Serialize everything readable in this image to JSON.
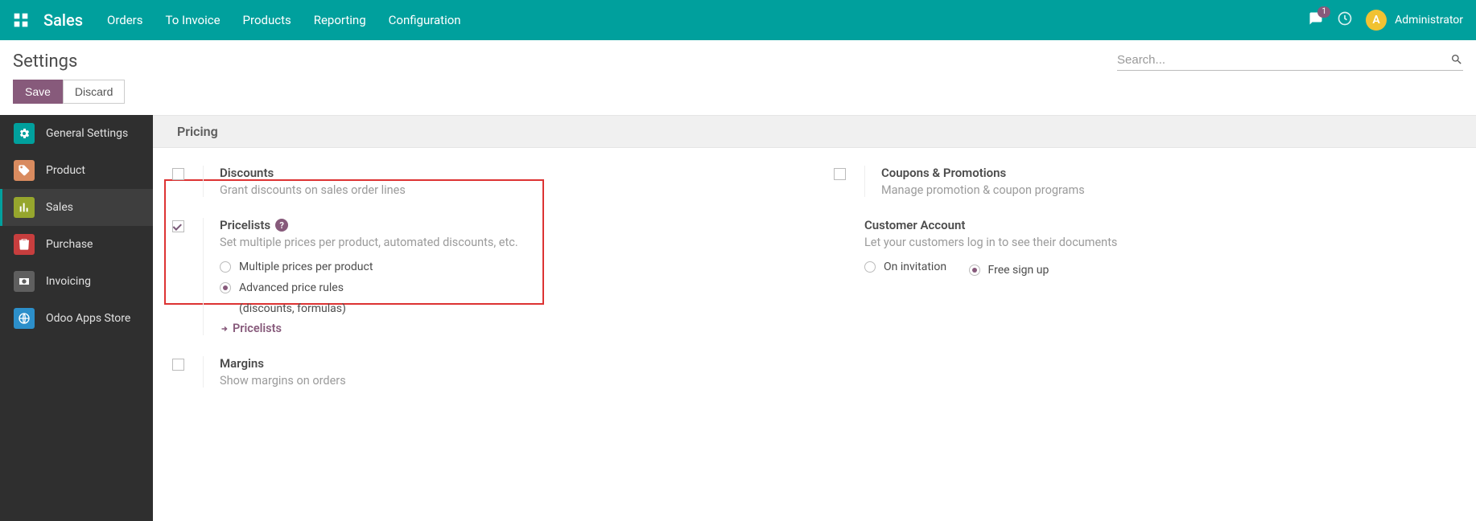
{
  "topnav": {
    "brand": "Sales",
    "items": [
      "Orders",
      "To Invoice",
      "Products",
      "Reporting",
      "Configuration"
    ],
    "chat_badge": "1",
    "user_initial": "A",
    "user_name": "Administrator"
  },
  "header": {
    "title": "Settings",
    "search_placeholder": "Search..."
  },
  "buttons": {
    "save": "Save",
    "discard": "Discard"
  },
  "sidebar": {
    "items": [
      {
        "label": "General Settings",
        "icon": "gear"
      },
      {
        "label": "Product",
        "icon": "tag"
      },
      {
        "label": "Sales",
        "icon": "chart",
        "active": true
      },
      {
        "label": "Purchase",
        "icon": "bag"
      },
      {
        "label": "Invoicing",
        "icon": "money"
      },
      {
        "label": "Odoo Apps Store",
        "icon": "globe"
      }
    ]
  },
  "section": {
    "title": "Pricing"
  },
  "settings": {
    "discounts": {
      "title": "Discounts",
      "desc": "Grant discounts on sales order lines"
    },
    "pricelists": {
      "title": "Pricelists",
      "desc": "Set multiple prices per product, automated discounts, etc.",
      "opt1": "Multiple prices per product",
      "opt2a": "Advanced price rules",
      "opt2b": "(discounts, formulas)",
      "link": "Pricelists"
    },
    "margins": {
      "title": "Margins",
      "desc": "Show margins on orders"
    },
    "coupons": {
      "title": "Coupons & Promotions",
      "desc": "Manage promotion & coupon programs"
    },
    "account": {
      "title": "Customer Account",
      "desc": "Let your customers log in to see their documents",
      "opt1": "On invitation",
      "opt2": "Free sign up"
    }
  }
}
